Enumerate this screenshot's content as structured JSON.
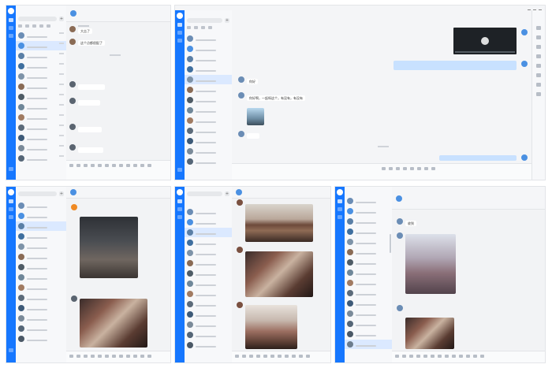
{
  "colors": {
    "accent": "#1677ff",
    "selected_row": "#dbe9ff",
    "my_bubble": "#c8e1ff"
  },
  "icons": [
    "plus-icon",
    "search-icon",
    "play-icon",
    "emoji-icon",
    "folder-icon",
    "image-icon",
    "scissors-icon",
    "mic-icon"
  ],
  "panel1": {
    "bubbles": [
      "大吉了",
      "这个点都很配了"
    ]
  },
  "panel2": {
    "window_title": "",
    "bubbles": [
      "你好",
      "你好啊，一起呀这个，有没有，有没有"
    ]
  },
  "panel3": {},
  "panel4": {},
  "panel5": {
    "bubbles": [
      "收到"
    ]
  }
}
